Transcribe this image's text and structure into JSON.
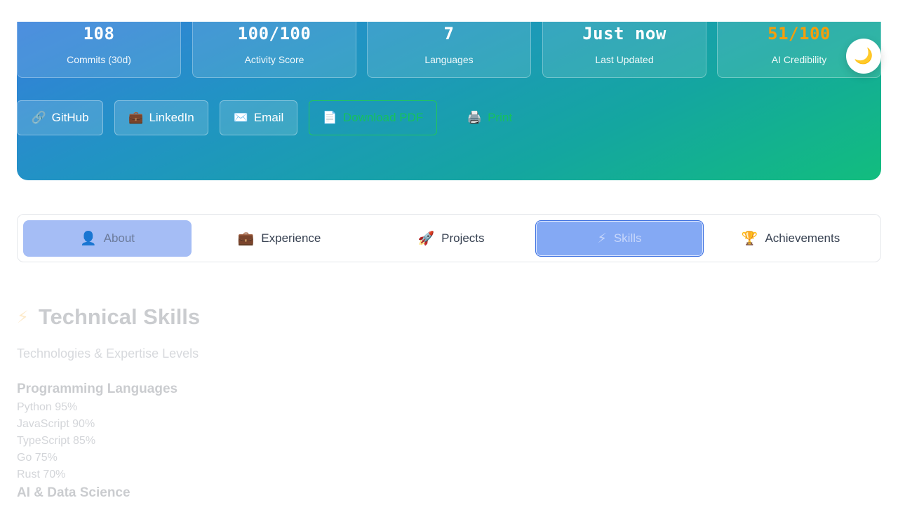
{
  "stats": [
    {
      "value": "108",
      "label": "Commits (30d)"
    },
    {
      "value": "100/100",
      "label": "Activity Score"
    },
    {
      "value": "7",
      "label": "Languages"
    },
    {
      "value": "Just now",
      "label": "Last Updated"
    },
    {
      "value": "51/100",
      "label": "AI Credibility"
    }
  ],
  "colors": {
    "accent_score": "#f59e0b",
    "pdf_green": "#22c55e",
    "hero_start": "#3a7be0",
    "hero_end": "#12bd7e"
  },
  "theme_toggle": {
    "icon": "🌙"
  },
  "actions": {
    "github": {
      "icon": "🔗",
      "label": "GitHub"
    },
    "linkedin": {
      "icon": "💼",
      "label": "LinkedIn"
    },
    "email": {
      "icon": "✉️",
      "label": "Email"
    },
    "pdf": {
      "icon": "📄",
      "label": "Download PDF"
    },
    "print": {
      "icon": "🖨️",
      "label": "Print"
    }
  },
  "tabs": [
    {
      "icon": "👤",
      "label": "About"
    },
    {
      "icon": "💼",
      "label": "Experience"
    },
    {
      "icon": "🚀",
      "label": "Projects"
    },
    {
      "icon": "⚡",
      "label": "Skills"
    },
    {
      "icon": "🏆",
      "label": "Achievements"
    }
  ],
  "skills_section": {
    "icon": "⚡",
    "title": "Technical Skills",
    "subtitle": "Technologies & Expertise Levels",
    "groups": [
      {
        "title": "Programming Languages",
        "skills": [
          {
            "label": "Python 95%",
            "level": 95
          },
          {
            "label": "JavaScript 90%",
            "level": 90
          },
          {
            "label": "TypeScript 85%",
            "level": 85
          },
          {
            "label": "Go 75%",
            "level": 75
          },
          {
            "label": "Rust 70%",
            "level": 70
          }
        ]
      },
      {
        "title": "AI & Data Science"
      }
    ]
  }
}
